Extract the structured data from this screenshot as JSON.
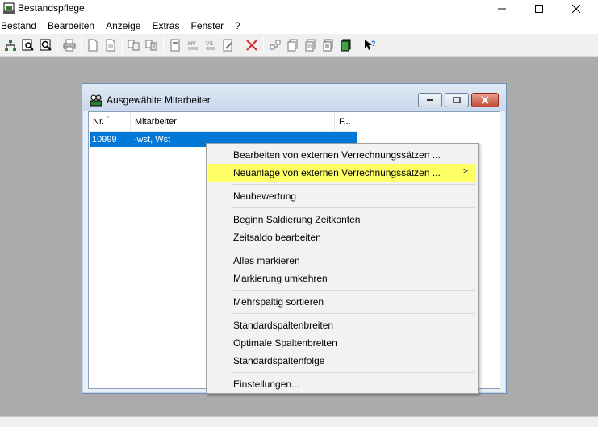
{
  "window": {
    "title": "Bestandspflege"
  },
  "menubar": {
    "items": [
      "Bestand",
      "Bearbeiten",
      "Anzeige",
      "Extras",
      "Fenster",
      "?"
    ]
  },
  "child_window": {
    "title": "Ausgewählte Mitarbeiter",
    "columns": [
      "Nr.",
      "Mitarbeiter",
      "F..."
    ],
    "rows": [
      {
        "nr": "10999",
        "mitarbeiter": "-wst, Wst"
      }
    ]
  },
  "context_menu": {
    "items": [
      "Bearbeiten von externen Verrechnungssätzen ...",
      "Neuanlage von externen Verrechnungssätzen ...",
      "Neubewertung",
      "Beginn Saldierung Zeitkonten",
      "Zeitsaldo bearbeiten",
      "Alles markieren",
      "Markierung umkehren",
      "Mehrspaltig sortieren",
      "Standardspaltenbreiten",
      "Optimale Spaltenbreiten",
      "Standardspaltenfolge",
      "Einstellungen..."
    ]
  },
  "colors": {
    "highlight": "#ffff66",
    "selection": "#0078d7"
  }
}
